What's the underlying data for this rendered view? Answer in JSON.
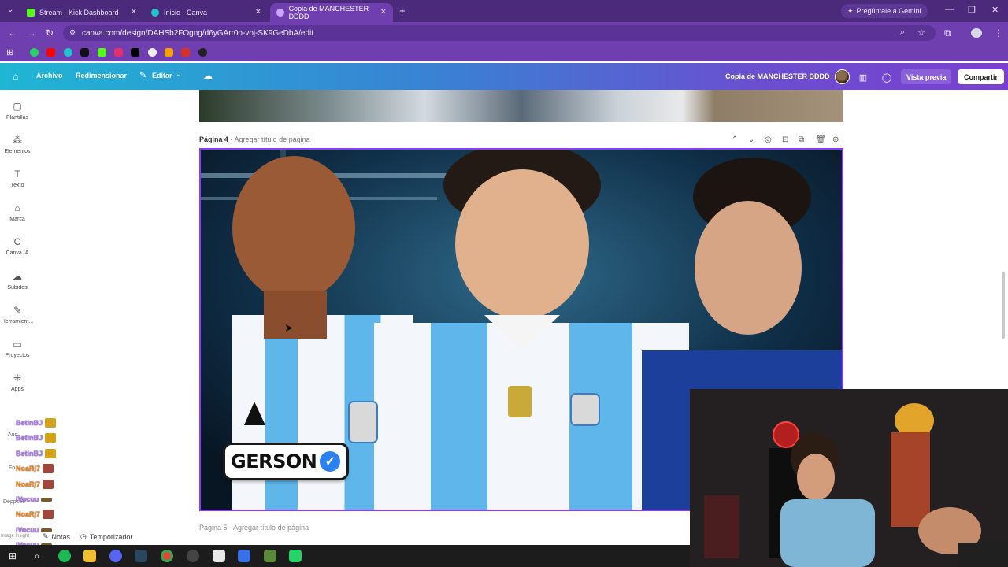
{
  "browser": {
    "tabs": [
      {
        "title": "Stream - Kick Dashboard",
        "active": false,
        "favicon_color": "#53fc18"
      },
      {
        "title": "Inicio - Canva",
        "active": false,
        "favicon_color": "#20c4cb"
      },
      {
        "title": "Copia de MANCHESTER DDDD",
        "active": true,
        "favicon_color": "#7b3fe4"
      }
    ],
    "gemini_label": "Pregúntale a Gemini",
    "url": "canva.com/design/DAHSb2FOgng/d6yGArr0o-voj-SK9GeDbA/edit"
  },
  "canva": {
    "header": {
      "archivo": "Archivo",
      "redimensionar": "Redimensionar",
      "editar": "Editar",
      "design_name": "Copia de MANCHESTER DDDD",
      "preview": "Vista previa",
      "share": "Compartir"
    },
    "sidebar": [
      {
        "label": "Plantillas",
        "icon": "templates-icon",
        "glyph": "▢"
      },
      {
        "label": "Elementos",
        "icon": "elements-icon",
        "glyph": "⁂"
      },
      {
        "label": "Texto",
        "icon": "text-icon",
        "glyph": "T"
      },
      {
        "label": "Marca",
        "icon": "brand-icon",
        "glyph": "⌂"
      },
      {
        "label": "Canva IA",
        "icon": "canva-ai-icon",
        "glyph": "C"
      },
      {
        "label": "Subidos",
        "icon": "uploads-icon",
        "glyph": "☁"
      },
      {
        "label": "Herramient...",
        "icon": "tools-icon",
        "glyph": "✎"
      },
      {
        "label": "Proyectos",
        "icon": "projects-icon",
        "glyph": "▭"
      },
      {
        "label": "Apps",
        "icon": "apps-icon",
        "glyph": "⁜"
      }
    ],
    "partial_sidebar": [
      "Aud",
      "Fo",
      "Deppsee",
      "Image Insight"
    ],
    "page": {
      "number": "Página 4",
      "title_placeholder": "- Agregar título de página",
      "thumbnail_tag": "GERSON",
      "next_page_label": "Página 5 - Agregar título de página"
    },
    "footer": {
      "notes": "Notas",
      "timer": "Temporizador"
    }
  },
  "chat_overlay": [
    {
      "name": "BetinBJ",
      "color": "purple"
    },
    {
      "name": "BetinBJ",
      "color": "purple"
    },
    {
      "name": "BetinBJ",
      "color": "purple"
    },
    {
      "name": "NoaRj7",
      "color": "orange"
    },
    {
      "name": "NoaRj7",
      "color": "orange"
    },
    {
      "name": "lVocuu",
      "color": "purple"
    },
    {
      "name": "NoaRj7",
      "color": "orange"
    },
    {
      "name": "lVocuu",
      "color": "purple"
    },
    {
      "name": "lVocuu",
      "color": "purple"
    }
  ],
  "colors": {
    "accent": "#8b3dff",
    "chrome": "#6f3fb0",
    "tabstrip": "#4b2a7b"
  }
}
